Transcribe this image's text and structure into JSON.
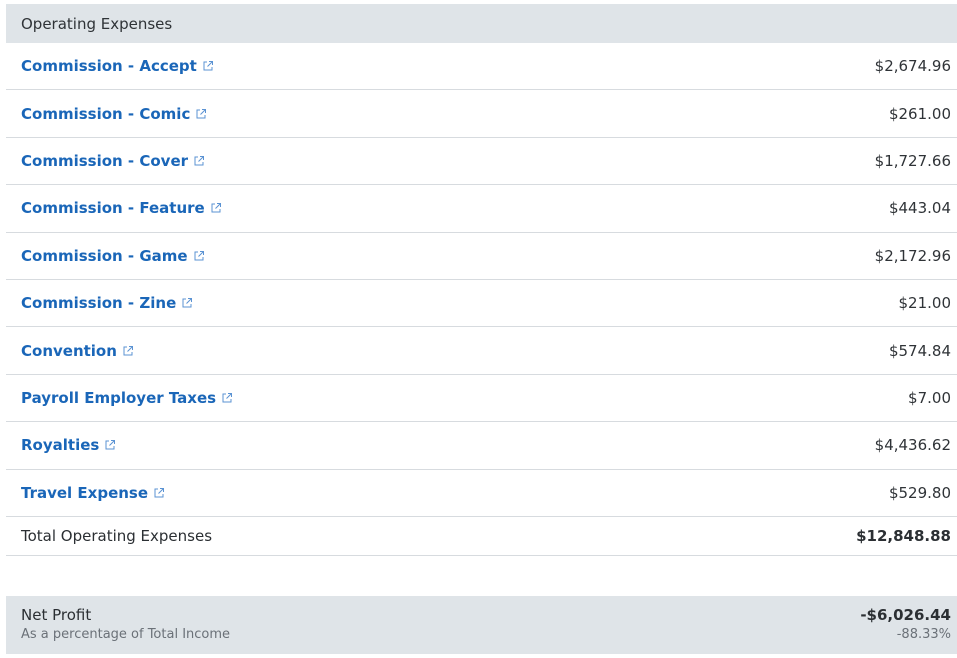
{
  "section": {
    "title": "Operating Expenses"
  },
  "rows": [
    {
      "label": "Commission - Accept",
      "amount": "$2,674.96"
    },
    {
      "label": "Commission - Comic",
      "amount": "$261.00"
    },
    {
      "label": "Commission - Cover",
      "amount": "$1,727.66"
    },
    {
      "label": "Commission - Feature",
      "amount": "$443.04"
    },
    {
      "label": "Commission - Game",
      "amount": "$2,172.96"
    },
    {
      "label": "Commission - Zine",
      "amount": "$21.00"
    },
    {
      "label": "Convention",
      "amount": "$574.84"
    },
    {
      "label": "Payroll Employer Taxes",
      "amount": "$7.00"
    },
    {
      "label": "Royalties",
      "amount": "$4,436.62"
    },
    {
      "label": "Travel Expense",
      "amount": "$529.80"
    }
  ],
  "total": {
    "label": "Total Operating Expenses",
    "amount": "$12,848.88"
  },
  "net_profit": {
    "title": "Net Profit",
    "subtitle": "As a percentage of Total Income",
    "amount": "-$6,026.44",
    "percentage": "-88.33%"
  },
  "colors": {
    "link": "#1a66b8",
    "header_bg": "#dfe4e8",
    "divider": "#d7dbdf"
  },
  "icons": {
    "row_link_icon": "external-link-icon"
  }
}
